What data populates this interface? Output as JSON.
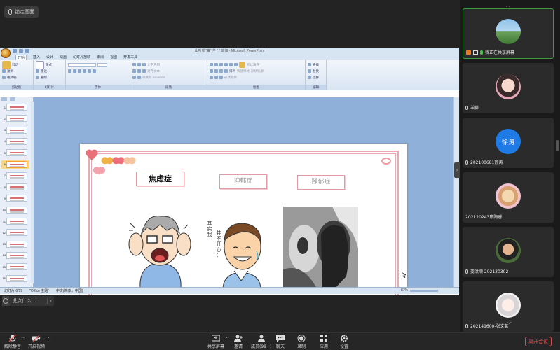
{
  "top": {
    "lock_label": "锁定画面"
  },
  "ppt": {
    "window_title": "山叶帽\"魔\"  兰  \"  \"  瑜伽 - Microsoft PowerPoint",
    "tabs": [
      "开始",
      "插入",
      "设计",
      "动画",
      "幻灯片放映",
      "审阅",
      "视图",
      "开发工具"
    ],
    "groups": [
      "剪贴板",
      "幻灯片",
      "字体",
      "段落",
      "绘图",
      "编辑"
    ],
    "clipboard": [
      "剪切",
      "复制",
      "格式刷"
    ],
    "slides_group": [
      "新建幻灯片",
      "版式",
      "重设",
      "删除"
    ],
    "paragraph": [
      "文字方向",
      "对齐文本",
      "转换为 SmartArt"
    ],
    "drawing": [
      "排列",
      "快速样式",
      "形状填充",
      "形状轮廓",
      "形状效果"
    ],
    "editing": [
      "查找",
      "替换",
      "选择"
    ],
    "thumb_numbers": [
      "1",
      "2",
      "3",
      "4",
      "5",
      "6",
      "7",
      "8",
      "9",
      "10",
      "11",
      "12",
      "13",
      "14",
      "15",
      "16"
    ],
    "active_slide": 6,
    "status_left": "幻灯片 6/19",
    "status_theme": "\"Office 主题\"",
    "status_lang": "中文(简体，中国)",
    "zoom": "87%",
    "slide": {
      "label_anxiety": "焦虑症",
      "label_depression": "抑郁症",
      "label_bipolar": "躁郁症",
      "handwriting_1": "其实我",
      "handwriting_2": "并不开心…"
    }
  },
  "chat": {
    "placeholder": "说点什么..."
  },
  "participants": [
    {
      "name": "我正在共享屏幕",
      "sharing": true
    },
    {
      "name": "羊藤",
      "sharing": false
    },
    {
      "name": "202100681徐涛",
      "initials": "徐涛",
      "avatar_color": "#1e7be5",
      "sharing": false
    },
    {
      "name": "202120243廖陶睿",
      "sharing": false
    },
    {
      "name": "姜洪顺  202130302",
      "sharing": false
    },
    {
      "name": "202141600-张文茗",
      "sharing": false
    }
  ],
  "toolbar": {
    "mute": "解除静音",
    "video": "开启视频",
    "share": "共享屏幕",
    "invite": "邀请",
    "members": "成员(99+)",
    "chat": "聊天",
    "record": "录制",
    "apps": "应用",
    "settings": "设置",
    "leave": "离开会议"
  },
  "colors": {
    "accent_pink": "#e8a9b3",
    "leave_red": "#e04848",
    "share_green": "#3c9a3c",
    "avatar_blue": "#1e7be5"
  }
}
